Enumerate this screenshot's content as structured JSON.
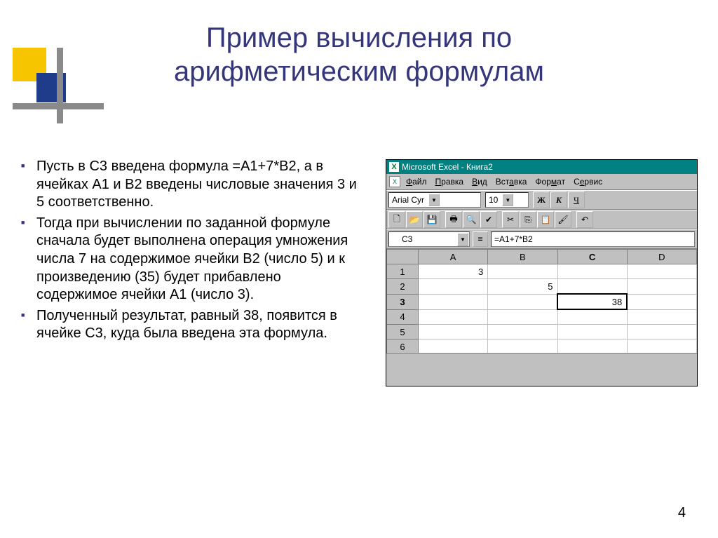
{
  "title_line1": "Пример вычисления по",
  "title_line2": "арифметическим формулам",
  "bullets": [
    "Пусть в С3 введена формула =А1+7*В2, а в ячейках А1 и В2 введены числовые значения 3 и 5 соответственно.",
    "Тогда при вычислении по заданной формуле сначала будет выполнена операция умножения числа 7 на содержимое ячейки В2 (число 5) и к произведению (35) будет прибавлено содержимое ячейки А1 (число 3).",
    "Полученный результат, равный 38, появится в ячейке С3, куда была введена эта формула."
  ],
  "excel": {
    "title": "Microsoft Excel - Книга2",
    "menu": [
      "Файл",
      "Правка",
      "Вид",
      "Вставка",
      "Формат",
      "Сервис"
    ],
    "font_name": "Arial Cyr",
    "font_size": "10",
    "toolbar_icons": [
      "new",
      "open",
      "save",
      "print",
      "preview",
      "spell",
      "cut",
      "copy",
      "paste",
      "format-painter",
      "undo"
    ],
    "bold_label": "Ж",
    "italic_label": "К",
    "underline_label": "Ч",
    "name_box": "C3",
    "formula": "=A1+7*B2",
    "columns": [
      "A",
      "B",
      "C",
      "D"
    ],
    "rows": [
      {
        "n": "1",
        "cells": [
          "3",
          "",
          "",
          ""
        ]
      },
      {
        "n": "2",
        "cells": [
          "",
          "5",
          "",
          ""
        ]
      },
      {
        "n": "3",
        "cells": [
          "",
          "",
          "38",
          ""
        ],
        "selected": 2
      },
      {
        "n": "4",
        "cells": [
          "",
          "",
          "",
          ""
        ]
      },
      {
        "n": "5",
        "cells": [
          "",
          "",
          "",
          ""
        ]
      },
      {
        "n": "6",
        "cells": [
          "",
          "",
          "",
          ""
        ]
      }
    ]
  },
  "page_number": "4"
}
